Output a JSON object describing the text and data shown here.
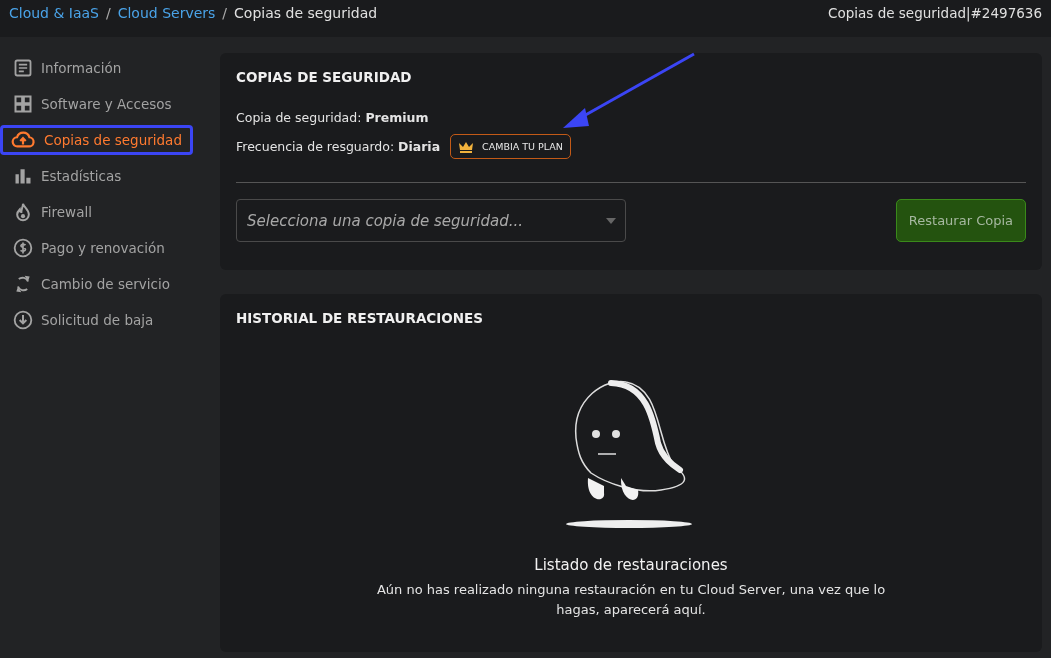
{
  "breadcrumb": [
    {
      "label": "Cloud & IaaS",
      "kind": "link"
    },
    {
      "label": "/",
      "kind": "separator"
    },
    {
      "label": "Cloud Servers",
      "kind": "link"
    },
    {
      "label": "/",
      "kind": "separator"
    },
    {
      "label": "Copias de seguridad",
      "kind": "current"
    }
  ],
  "page_title": "Copias de seguridad|#2497636",
  "sidebar": {
    "items": [
      {
        "label": "Información",
        "selected": false
      },
      {
        "label": "Software y Accesos",
        "selected": false
      },
      {
        "label": "Copias de seguridad",
        "selected": true
      },
      {
        "label": "Estadísticas",
        "selected": false
      },
      {
        "label": "Firewall",
        "selected": false
      },
      {
        "label": "Pago y renovación",
        "selected": false
      },
      {
        "label": "Cambio de servicio",
        "selected": false
      },
      {
        "label": "Solicitud de baja",
        "selected": false
      }
    ]
  },
  "backup_panel": {
    "title": "COPIAS DE SEGURIDAD",
    "backup_line": "Copia de seguridad: **Premium**",
    "frequency_line": "Frecuencia de resguardo: **Diaria**",
    "upgrade_button": "CAMBIA TU PLAN",
    "select": {
      "placeholder": "Selecciona una copia de seguridad..."
    },
    "restore_button": "Restaurar Copia"
  },
  "history_panel": {
    "title": "HISTORIAL DE RESTAURACIONES",
    "empty_title": "Listado de restauraciones",
    "empty_text": "Aún no has realizado ninguna restauración en tu Cloud Server, una vez que lo hagas, aparecerá aquí."
  }
}
